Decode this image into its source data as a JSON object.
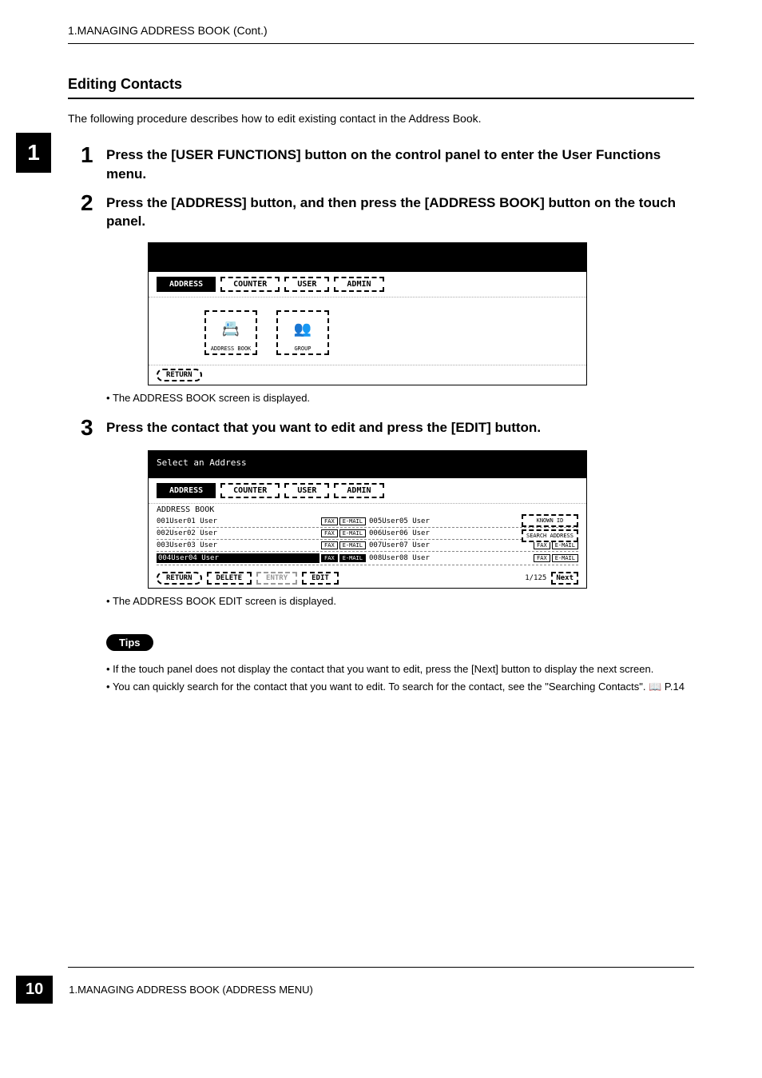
{
  "header": "1.MANAGING ADDRESS BOOK (Cont.)",
  "chapter_tab": "1",
  "section_title": "Editing Contacts",
  "intro": "The following procedure describes how to edit existing contact in the Address Book.",
  "steps": [
    {
      "num": "1",
      "text": "Press the [USER FUNCTIONS] button on the control panel to enter the User Functions menu."
    },
    {
      "num": "2",
      "text": "Press the [ADDRESS] button, and then press the [ADDRESS BOOK] button on the touch panel."
    },
    {
      "num": "3",
      "text": "Press the contact that you want to edit and press the [EDIT] button."
    }
  ],
  "panel1": {
    "tabs": [
      "ADDRESS",
      "COUNTER",
      "USER",
      "ADMIN"
    ],
    "active_tab": "ADDRESS",
    "icons": [
      {
        "label": "ADDRESS BOOK",
        "glyph": "📇"
      },
      {
        "label": "GROUP",
        "glyph": "👥"
      }
    ],
    "return": "RETURN"
  },
  "note1_bullet": "The ADDRESS BOOK screen is displayed.",
  "panel2": {
    "select_header": "Select an Address",
    "tabs": [
      "ADDRESS",
      "COUNTER",
      "USER",
      "ADMIN"
    ],
    "active_tab": "ADDRESS",
    "subtitle": "ADDRESS BOOK",
    "contacts_left": [
      {
        "id": "001",
        "name": "User01 User"
      },
      {
        "id": "002",
        "name": "User02 User"
      },
      {
        "id": "003",
        "name": "User03 User"
      },
      {
        "id": "004",
        "name": "User04 User",
        "selected": true
      }
    ],
    "contacts_right": [
      {
        "id": "005",
        "name": "User05 User"
      },
      {
        "id": "006",
        "name": "User06 User"
      },
      {
        "id": "007",
        "name": "User07 User"
      },
      {
        "id": "008",
        "name": "User08 User"
      }
    ],
    "mini_fax": "FAX",
    "mini_email": "E-MAIL",
    "side_known": "KNOWN ID",
    "side_search": "SEARCH ADDRESS",
    "actions": {
      "return": "RETURN",
      "delete": "DELETE",
      "entry": "ENTRY",
      "edit": "EDIT",
      "page": "1/125",
      "next": "Next"
    }
  },
  "note2_bullet": "The ADDRESS BOOK EDIT screen is displayed.",
  "tips_label": "Tips",
  "tips": [
    "If the touch panel does not display the contact that you want to edit, press the [Next] button to display the next screen.",
    "You can quickly search for the contact that you want to edit.  To search for the contact, see the \"Searching Contacts\". 📖 P.14"
  ],
  "footer": {
    "page_num": "10",
    "text": "1.MANAGING ADDRESS BOOK (ADDRESS MENU)"
  }
}
